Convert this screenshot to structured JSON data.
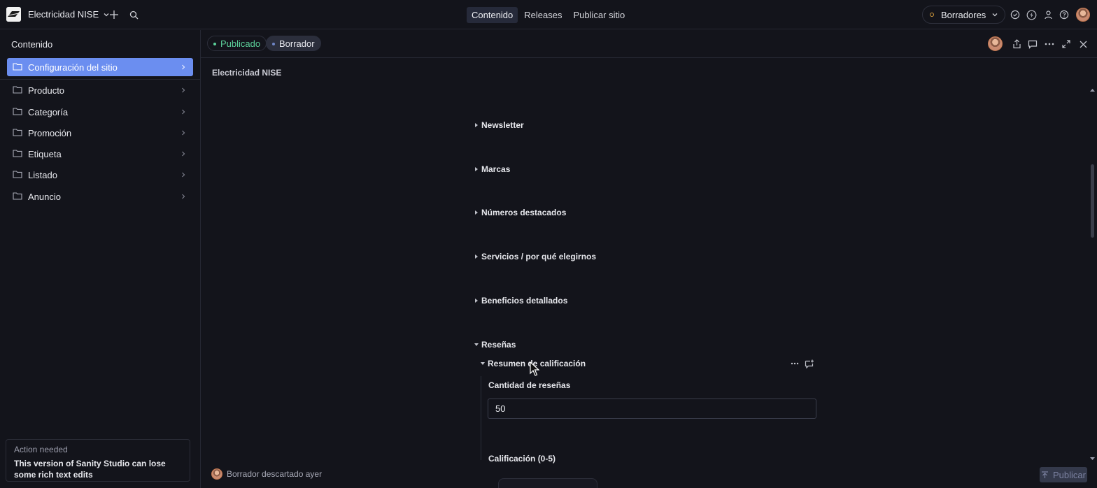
{
  "topbar": {
    "workspace_name": "Electricidad NISE",
    "nav_tabs": [
      {
        "label": "Contenido",
        "active": true
      },
      {
        "label": "Releases",
        "active": false
      },
      {
        "label": "Publicar sitio",
        "active": false
      }
    ],
    "perspective_label": "Borradores"
  },
  "sidebar": {
    "title": "Contenido",
    "items": [
      {
        "label": "Configuración del sitio",
        "active": true
      },
      {
        "label": "Producto"
      },
      {
        "label": "Categoría"
      },
      {
        "label": "Promoción"
      },
      {
        "label": "Etiqueta"
      },
      {
        "label": "Listado"
      },
      {
        "label": "Anuncio"
      }
    ],
    "notice": {
      "title": "Action needed",
      "body": "This version of Sanity Studio can lose some rich text edits"
    }
  },
  "document": {
    "status_published": "Publicado",
    "status_draft": "Borrador",
    "title": "Electricidad NISE",
    "sections": [
      {
        "label": "Newsletter",
        "expanded": false
      },
      {
        "label": "Marcas",
        "expanded": false
      },
      {
        "label": "Números destacados",
        "expanded": false
      },
      {
        "label": "Servicios / por qué elegirnos",
        "expanded": false
      },
      {
        "label": "Beneficios detallados",
        "expanded": false
      },
      {
        "label": "Reseñas",
        "expanded": true
      }
    ],
    "subsection": {
      "label": "Resumen de calificación",
      "expanded": true
    },
    "fields": {
      "review_count_label": "Cantidad de reseñas",
      "review_count_value": "50",
      "rating_label": "Calificación (0-5)"
    }
  },
  "footer": {
    "status_text": "Borrador descartado ayer",
    "publish_label": "Publicar"
  },
  "colors": {
    "background": "#13141b",
    "accent": "#6b8ef0",
    "published": "#5cd19a",
    "perspective_dot": "#d39a3c"
  }
}
